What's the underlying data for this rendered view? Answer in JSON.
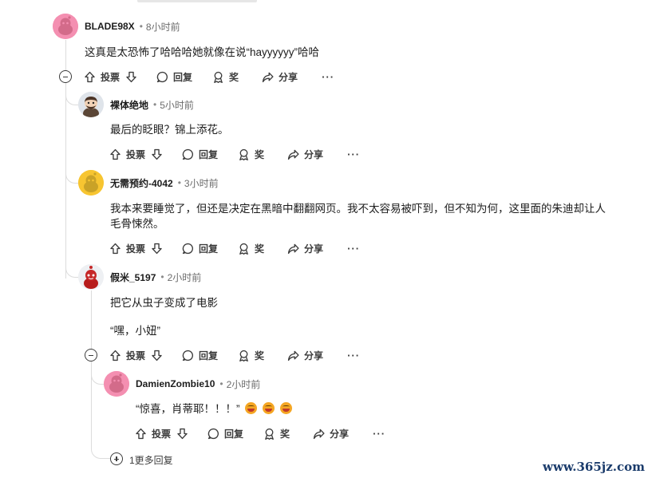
{
  "actions": {
    "vote_label": "投票",
    "reply_label": "回复",
    "award_label": "奖",
    "share_label": "分享",
    "more_label": "···"
  },
  "comments": [
    {
      "author": "BLADE98X",
      "time": "8小时前",
      "lines": [
        "这真是太恐怖了哈哈哈她就像在说“hayyyyyy”哈哈"
      ],
      "avatar": "pink-snoo"
    },
    {
      "author": "裸体绝地",
      "time": "5小时前",
      "lines": [
        "最后的眨眼？锦上添花。"
      ],
      "avatar": "bearded-snoo"
    },
    {
      "author": "无需预约-4042",
      "time": "3小时前",
      "lines": [
        "我本来要睡觉了，但还是决定在黑暗中翻翻网页。我不太容易被吓到，但不知为何，这里面的朱迪却让人",
        "毛骨悚然。"
      ],
      "avatar": "yellow-snoo"
    },
    {
      "author": "假米_5197",
      "time": "2小时前",
      "lines": [
        "把它从虫子变成了电影",
        "“嘿，小妞”"
      ],
      "avatar": "red-snoo"
    },
    {
      "author": "DamienZombie10",
      "time": "2小时前",
      "lines": [
        "“惊喜，肖蒂耶！！！”"
      ],
      "avatar": "pink-snoo",
      "emoji_count": 3
    }
  ],
  "more_replies_label": "1更多回复",
  "watermark": "www.365jz.com",
  "colors": {
    "thread_line": "#dcdcdc",
    "watermark": "#1a3b6b",
    "pink_avatar": "#f48fb1",
    "yellow_avatar": "#f7c531"
  }
}
